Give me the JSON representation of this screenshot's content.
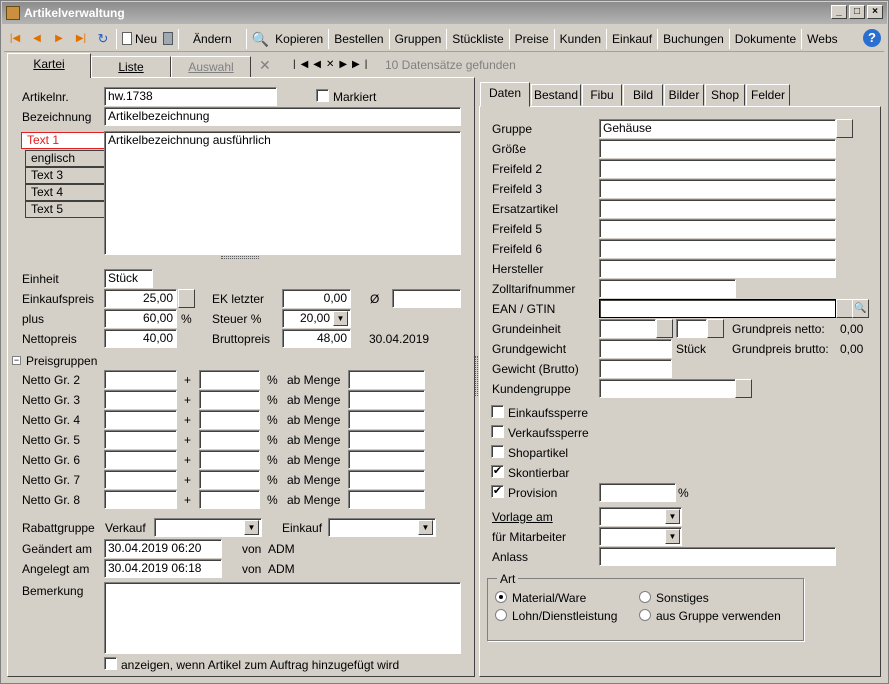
{
  "window": {
    "title": "Artikelverwaltung"
  },
  "toolbar": {
    "neu": "Neu",
    "aendern": "Ändern",
    "kopieren": "Kopieren",
    "bestellen": "Bestellen",
    "gruppen": "Gruppen",
    "stueckliste": "Stückliste",
    "preise": "Preise",
    "kunden": "Kunden",
    "einkauf": "Einkauf",
    "buchungen": "Buchungen",
    "dokumente": "Dokumente",
    "webshop": "Webs"
  },
  "leftTabs": {
    "kartei": "Kartei",
    "liste": "Liste",
    "auswahl": "Auswahl",
    "records": "10 Datensätze gefunden"
  },
  "form": {
    "artikelnr_label": "Artikelnr.",
    "artikelnr": "hw.1738",
    "markiert": "Markiert",
    "bezeichnung_label": "Bezeichnung",
    "bezeichnung": "Artikelbezeichnung",
    "text1": "Text 1",
    "englisch": "englisch",
    "text3": "Text 3",
    "text4": "Text 4",
    "text5": "Text 5",
    "beschreibung": "Artikelbezeichnung ausführlich",
    "einheit_label": "Einheit",
    "einheit": "Stück",
    "einkaufspreis_label": "Einkaufspreis",
    "einkaufspreis": "25,00",
    "ek_letzter_label": "EK letzter",
    "ek_letzter": "0,00",
    "avg_label": "Ø",
    "plus_label": "plus",
    "plus": "60,00",
    "pct": "%",
    "steuer_label": "Steuer %",
    "steuer": "20,00",
    "netto_label": "Nettopreis",
    "netto": "40,00",
    "brutto_label": "Bruttopreis",
    "brutto": "48,00",
    "datum": "30.04.2019",
    "preisgruppen": "Preisgruppen",
    "gruppen": [
      "Netto Gr. 2",
      "Netto Gr. 3",
      "Netto Gr. 4",
      "Netto Gr. 5",
      "Netto Gr. 6",
      "Netto Gr. 7",
      "Netto Gr. 8"
    ],
    "plus_sign": "+",
    "ab_menge": "ab Menge",
    "rabatt_label": "Rabattgruppe",
    "verkauf": "Verkauf",
    "einkauf": "Einkauf",
    "geaendert_label": "Geändert am",
    "geaendert": "30.04.2019 06:20",
    "von": "von",
    "user1": "ADM",
    "angelegt_label": "Angelegt am",
    "angelegt": "30.04.2019 06:18",
    "user2": "ADM",
    "bemerkung_label": "Bemerkung",
    "anzeigen": "anzeigen, wenn Artikel zum Auftrag hinzugefügt wird"
  },
  "rightTabs": [
    "Daten",
    "Bestand",
    "Fibu",
    "Bild",
    "Bilder",
    "Shop",
    "Felder"
  ],
  "daten": {
    "gruppe_label": "Gruppe",
    "gruppe": "Gehäuse",
    "groesse": "Größe",
    "freifeld2": "Freifeld 2",
    "freifeld3": "Freifeld 3",
    "ersatzartikel": "Ersatzartikel",
    "freifeld5": "Freifeld 5",
    "freifeld6": "Freifeld 6",
    "hersteller": "Hersteller",
    "zolltarif": "Zolltarifnummer",
    "ean": "EAN / GTIN",
    "grundeinheit": "Grundeinheit",
    "grundpreis_netto": "Grundpreis netto:",
    "gpn_val": "0,00",
    "grundgewicht": "Grundgewicht",
    "stueck": "Stück",
    "grundpreis_brutto": "Grundpreis brutto:",
    "gpb_val": "0,00",
    "gewicht": "Gewicht (Brutto)",
    "kundengruppe": "Kundengruppe",
    "einkaufssperre": "Einkaufssperre",
    "verkaufssperre": "Verkaufssperre",
    "shopartikel": "Shopartikel",
    "skontierbar": "Skontierbar",
    "provision": "Provision",
    "prov_pct": "%",
    "vorlage": "Vorlage am",
    "mitarbeiter": "für Mitarbeiter",
    "anlass": "Anlass",
    "art": "Art",
    "material": "Material/Ware",
    "sonstiges": "Sonstiges",
    "lohn": "Lohn/Dienstleistung",
    "ausgruppe": "aus Gruppe verwenden"
  }
}
